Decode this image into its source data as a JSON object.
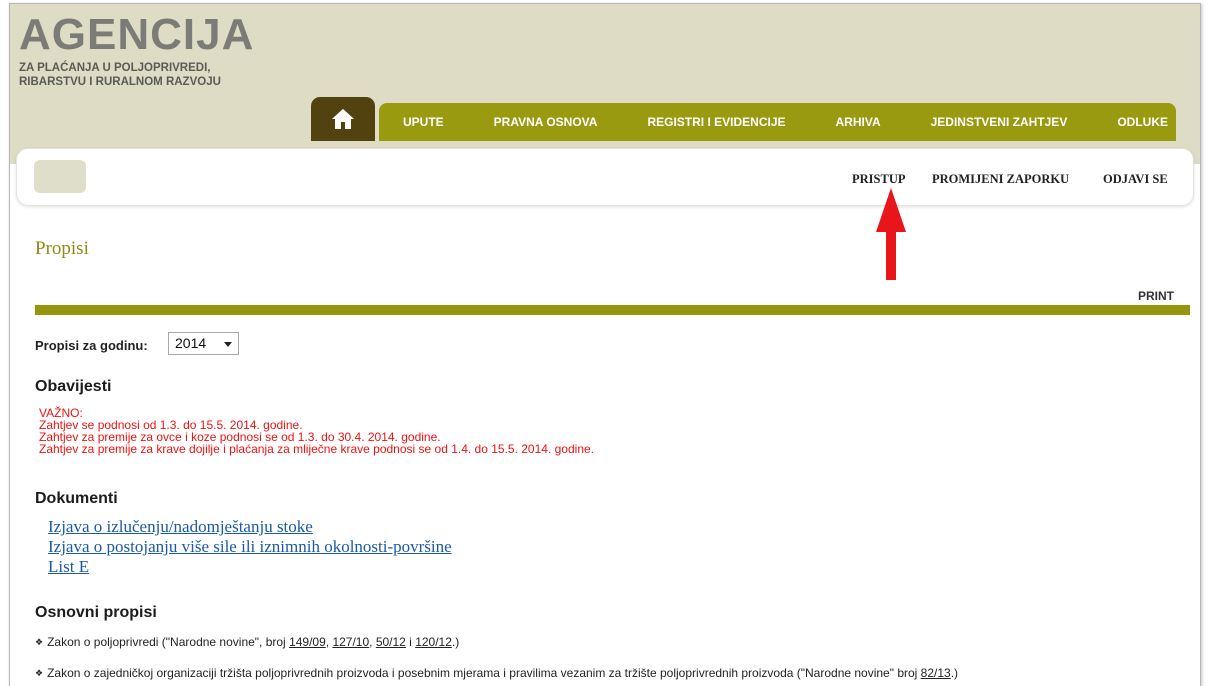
{
  "header": {
    "logo_title": "AGENCIJA",
    "logo_sub_line1": "ZA PLAĆANJA U POLJOPRIVREDI,",
    "logo_sub_line2": "RIBARSTVU I RURALNOM RAZVOJU"
  },
  "nav": {
    "home_icon": "home-icon",
    "items": [
      {
        "label": "UPUTE"
      },
      {
        "label": "PRAVNA OSNOVA"
      },
      {
        "label": "REGISTRI I EVIDENCIJE"
      },
      {
        "label": "ARHIVA"
      },
      {
        "label": "JEDINSTVENI ZAHTJEV"
      },
      {
        "label": "ODLUKE"
      }
    ]
  },
  "userbar": {
    "pristup": "PRISTUP",
    "promijeni": "PROMIJENI ZAPORKU",
    "odjavi": "ODJAVI SE"
  },
  "page": {
    "title": "Propisi",
    "print": "PRINT",
    "year_label": "Propisi za godinu:",
    "year_value": "2014"
  },
  "obavijesti": {
    "heading": "Obavijesti",
    "lines": [
      "VAŽNO:",
      "Zahtjev se podnosi od 1.3. do 15.5. 2014. godine.",
      "Zahtjev za premije za ovce i koze podnosi se od 1.3. do 30.4. 2014. godine.",
      "Zahtjev za premije za krave dojilje i plaćanja za mliječne krave podnosi se od 1.4. do 15.5. 2014. godine."
    ]
  },
  "dokumenti": {
    "heading": "Dokumenti",
    "links": [
      "Izjava o izlučenju/nadomještanju stoke",
      "Izjava o postojanju više sile ili iznimnih okolnosti-površine",
      "List E"
    ]
  },
  "osnovni": {
    "heading": "Osnovni propisi",
    "law1_text": "Zakon o poljoprivredi (\"Narodne novine\", broj ",
    "law1_refs": [
      "149/09",
      "127/10",
      "50/12",
      "120/12"
    ],
    "law1_sep1": ", ",
    "law1_sep2": ", ",
    "law1_sep3": " i ",
    "law1_end": ".)",
    "law2_text": "Zakon o zajedničkoj organizaciji tržišta poljoprivrednih proizvoda i posebnim mjerama i pravilima vezanim za tržište poljoprivrednih proizvoda (\"Narodne novine\" broj ",
    "law2_ref": "82/13",
    "law2_end": ".)"
  },
  "colors": {
    "nav_green": "#9a9a10",
    "home_brown": "#51420f",
    "header_bg": "#dedcc4",
    "title_olive": "#8e8a13",
    "notice_red": "#ee1111",
    "link_blue": "#1a5aa6",
    "annotation_arrow": "#e8151b"
  }
}
